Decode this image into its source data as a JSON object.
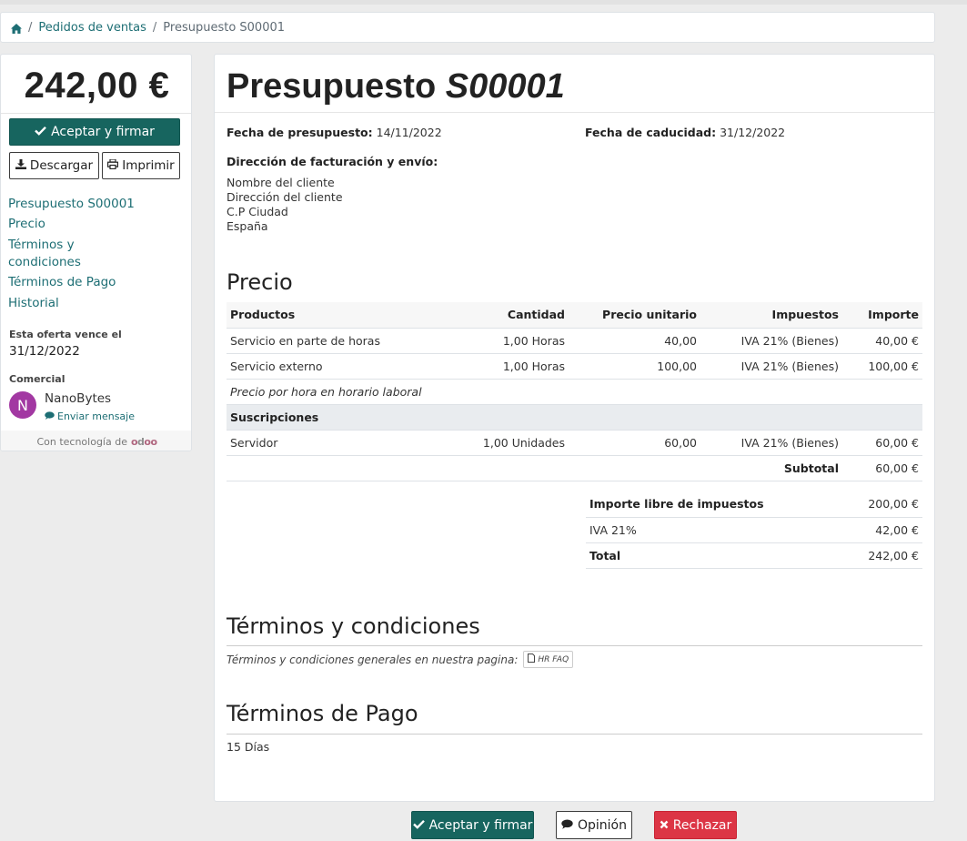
{
  "breadcrumb": {
    "home_icon": "home-icon",
    "items": [
      "Pedidos de ventas",
      "Presupuesto S00001"
    ],
    "separator": "/"
  },
  "sidebar": {
    "amount": "242,00 €",
    "accept_label": "Aceptar y firmar",
    "download_label": "Descargar",
    "print_label": "Imprimir",
    "nav": [
      "Presupuesto S00001",
      "Precio",
      "Términos y condiciones",
      "Términos de Pago",
      "Historial"
    ],
    "expires_label": "Esta oferta vence el",
    "expires_date": "31/12/2022",
    "salesperson_label": "Comercial",
    "avatar_initial": "N",
    "salesperson_name": "NanoBytes",
    "message_link": "Enviar mensaje",
    "powered_by": "Con tecnología de",
    "powered_logo": "odoo"
  },
  "document": {
    "title_prefix": "Presupuesto",
    "title_ref": "S00001",
    "quote_date_label": "Fecha de presupuesto:",
    "quote_date": "14/11/2022",
    "expiry_label": "Fecha de caducidad:",
    "expiry_date": "31/12/2022",
    "address_label": "Dirección de facturación y envío:",
    "address_lines": [
      "Nombre del cliente",
      "Dirección del cliente",
      "C.P Ciudad",
      "España"
    ]
  },
  "pricing": {
    "heading": "Precio",
    "columns": [
      "Productos",
      "Cantidad",
      "Precio unitario",
      "Impuestos",
      "Importe"
    ],
    "rows": [
      {
        "product": "Servicio en parte de horas",
        "qty": "1,00 Horas",
        "unit_price": "40,00",
        "taxes": "IVA 21% (Bienes)",
        "amount": "40,00 €"
      },
      {
        "product": "Servicio externo",
        "qty": "1,00 Horas",
        "unit_price": "100,00",
        "taxes": "IVA 21% (Bienes)",
        "amount": "100,00 €"
      }
    ],
    "note": "Precio por hora en horario laboral",
    "section": "Suscripciones",
    "section_rows": [
      {
        "product": "Servidor",
        "qty": "1,00 Unidades",
        "unit_price": "60,00",
        "taxes": "IVA 21% (Bienes)",
        "amount": "60,00 €"
      }
    ],
    "subtotal_label": "Subtotal",
    "subtotal_value": "60,00 €"
  },
  "totals": {
    "untaxed_label": "Importe libre de impuestos",
    "untaxed_value": "200,00 €",
    "tax_label": "IVA 21%",
    "tax_value": "42,00 €",
    "total_label": "Total",
    "total_value": "242,00 €"
  },
  "terms": {
    "heading": "Términos y condiciones",
    "text": "Términos y condiciones generales en nuestra pagina:",
    "link_label": "HR FAQ"
  },
  "payment_terms": {
    "heading": "Términos de Pago",
    "value": "15 Días"
  },
  "footer_buttons": {
    "accept": "Aceptar y firmar",
    "feedback": "Opinión",
    "reject": "Rechazar"
  },
  "colors": {
    "primary": "#17655f",
    "link": "#1d6e74",
    "danger": "#dc3545",
    "avatar": "#a238a2"
  }
}
